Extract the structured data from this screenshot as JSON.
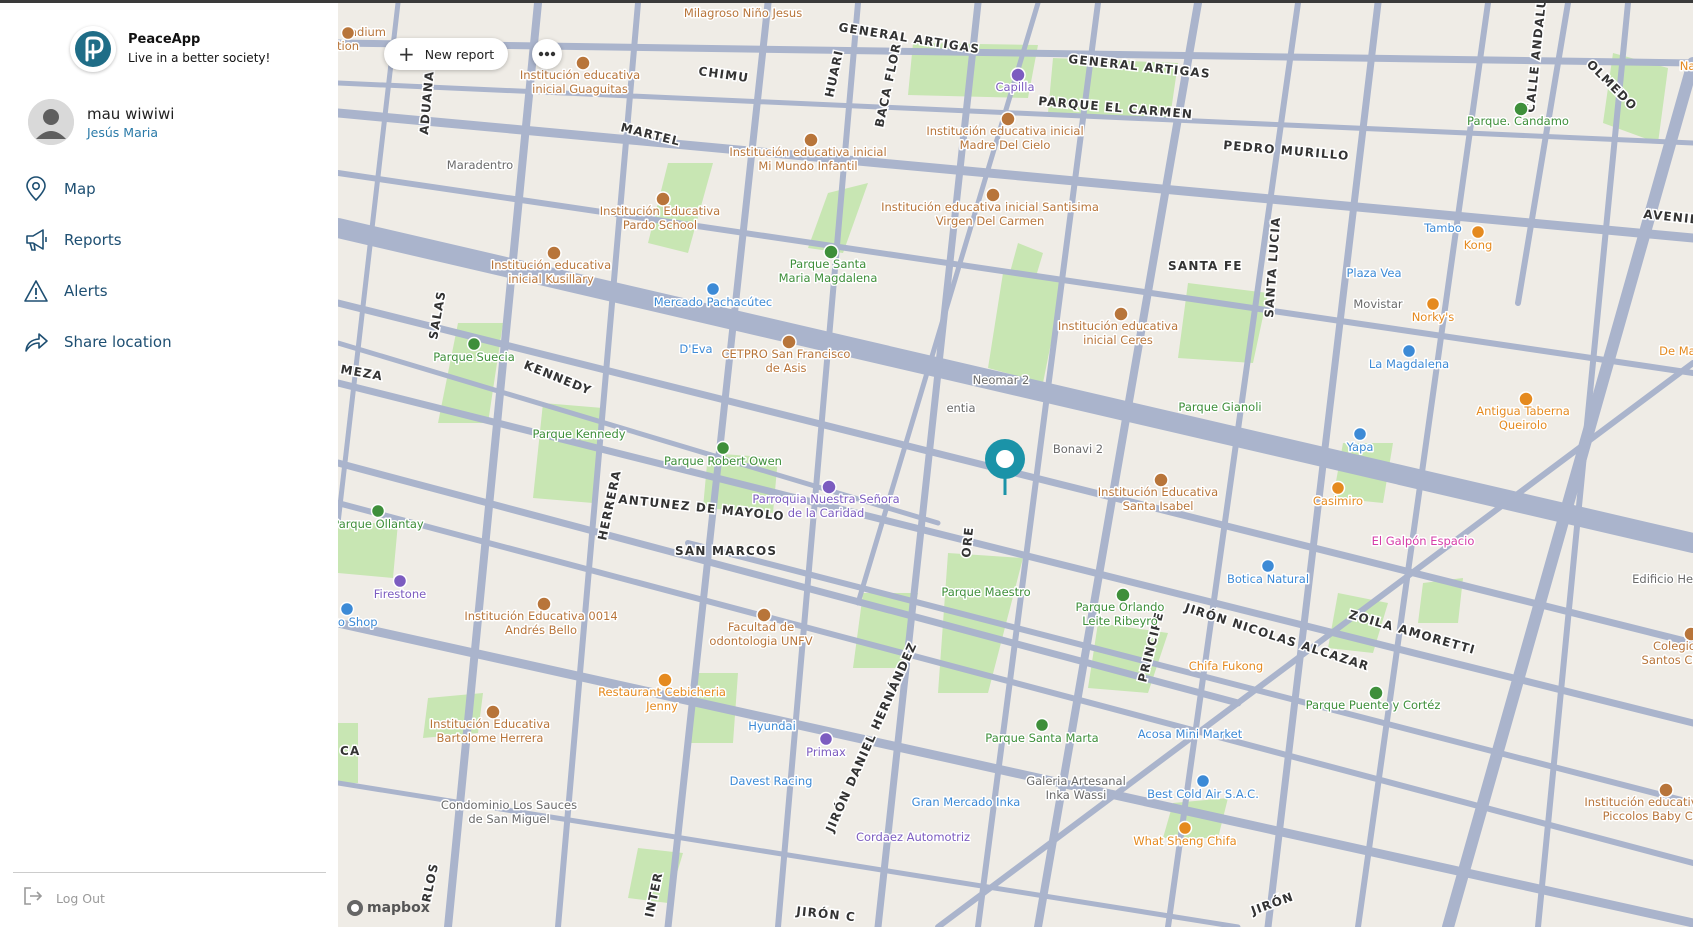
{
  "app": {
    "name": "PeaceApp",
    "tagline": "Live in a better society!"
  },
  "user": {
    "name": "mau wiwiwi",
    "location": "Jesús Maria"
  },
  "nav": {
    "items": [
      {
        "label": "Map",
        "icon": "map-pin-icon"
      },
      {
        "label": "Reports",
        "icon": "megaphone-icon"
      },
      {
        "label": "Alerts",
        "icon": "warning-icon"
      },
      {
        "label": "Share location",
        "icon": "share-arrow-icon"
      }
    ],
    "logout_label": "Log Out"
  },
  "toolbar": {
    "new_report_label": "New report",
    "more_icon": "ellipsis-icon"
  },
  "map": {
    "attribution": "mapbox",
    "pin_color": "#1b93a8",
    "colors": {
      "park": "#c8e6b3",
      "road": "#aab4cc",
      "land": "#efece6",
      "poi_school": "#b8753a",
      "poi_park": "#3e8f3a",
      "poi_shop": "#3c8ad6",
      "poi_food": "#e58a1f",
      "poi_service": "#7c5cc0",
      "poi_art": "#d63ca8"
    },
    "streets": [
      {
        "text": "GENERAL ARTIGAS"
      },
      {
        "text": "GENERAL ARTIGAS"
      },
      {
        "text": "CHIMU"
      },
      {
        "text": "HUARI"
      },
      {
        "text": "BACA FLOR"
      },
      {
        "text": "ADUANA"
      },
      {
        "text": "MARTEL"
      },
      {
        "text": "PARQUE EL CARMEN"
      },
      {
        "text": "PEDRO MURILLO"
      },
      {
        "text": "CALLE ANDALUCIA"
      },
      {
        "text": "OLMEDO"
      },
      {
        "text": "AVENIDA"
      },
      {
        "text": "SANTA FE"
      },
      {
        "text": "SANTA LUCIA"
      },
      {
        "text": "SALAS"
      },
      {
        "text": "MEZA"
      },
      {
        "text": "KENNEDY"
      },
      {
        "text": "ANTUNEZ DE MAYOLO"
      },
      {
        "text": "HERRERA"
      },
      {
        "text": "SAN MARCOS"
      },
      {
        "text": "JIRÓN DANIEL HERNÁNDEZ"
      },
      {
        "text": "ORE"
      },
      {
        "text": "PRINCIPE"
      },
      {
        "text": "JIRÓN NICOLAS ALCAZAR"
      },
      {
        "text": "ZOILA AMORETTI"
      },
      {
        "text": "CA"
      },
      {
        "text": "RLOS"
      },
      {
        "text": "INTER"
      },
      {
        "text": "JIRÓN C"
      },
      {
        "text": "JIRÓN"
      }
    ],
    "pois": [
      {
        "text": "Milagroso Niño Jesus",
        "type": "school"
      },
      {
        "text": "adium",
        "type": "school"
      },
      {
        "text": "tion",
        "type": "school"
      },
      {
        "text": "Institución educativa inicial Guaguitas",
        "type": "school"
      },
      {
        "text": "Capilla",
        "type": "service"
      },
      {
        "text": "Institución educativa inicial Madre Del Cielo",
        "type": "school"
      },
      {
        "text": "Institución educativa inicial Mi Mundo Infantil",
        "type": "school"
      },
      {
        "text": "Maradentro",
        "type": "other"
      },
      {
        "text": "Institución Educativa Pardo School",
        "type": "school"
      },
      {
        "text": "Institución educativa inicial Santisima Virgen Del Carmen",
        "type": "school"
      },
      {
        "text": "Parque. Candamo",
        "type": "park"
      },
      {
        "text": "Tambo",
        "type": "shop"
      },
      {
        "text": "Kong",
        "type": "food"
      },
      {
        "text": "Plaza Vea",
        "type": "shop"
      },
      {
        "text": "Institución educativa inicial Kusillary",
        "type": "school"
      },
      {
        "text": "Parque Santa Maria Magdalena",
        "type": "park"
      },
      {
        "text": "Mercado Pachacútec",
        "type": "shop"
      },
      {
        "text": "Movistar",
        "type": "other"
      },
      {
        "text": "Norky's",
        "type": "food"
      },
      {
        "text": "Institución educativa inicial Ceres",
        "type": "school"
      },
      {
        "text": "Parque Suecia",
        "type": "park"
      },
      {
        "text": "D'Eva",
        "type": "shop"
      },
      {
        "text": "CETPRO San Francisco de Asis",
        "type": "school"
      },
      {
        "text": "De Mam",
        "type": "food"
      },
      {
        "text": "La Magdalena",
        "type": "shop"
      },
      {
        "text": "Neomar 2",
        "type": "other"
      },
      {
        "text": "entia",
        "type": "other"
      },
      {
        "text": "Parque Gianoli",
        "type": "park"
      },
      {
        "text": "Antigua Taberna Queirolo",
        "type": "food"
      },
      {
        "text": "Parque Kennedy",
        "type": "park"
      },
      {
        "text": "Parque Robert Owen",
        "type": "park"
      },
      {
        "text": "Bonavi 2",
        "type": "other"
      },
      {
        "text": "Yapa",
        "type": "shop"
      },
      {
        "text": "Institución Educativa Santa Isabel",
        "type": "school"
      },
      {
        "text": "Casimiro",
        "type": "food"
      },
      {
        "text": "Parroquia Nuestra Señora de la Caridad",
        "type": "service"
      },
      {
        "text": "Parque Ollantay",
        "type": "park"
      },
      {
        "text": "El Galpón Espacio",
        "type": "art"
      },
      {
        "text": "Firestone",
        "type": "service"
      },
      {
        "text": "Parque Maestro",
        "type": "park"
      },
      {
        "text": "Botica Natural",
        "type": "shop"
      },
      {
        "text": "Edificio Herc",
        "type": "other"
      },
      {
        "text": "Institución Educativa 0014 Andrés Bello",
        "type": "school"
      },
      {
        "text": "Parque Orlando Leite Ribeyro",
        "type": "park"
      },
      {
        "text": "Moto Shop",
        "type": "shop"
      },
      {
        "text": "Facultad de odontologia UNFV",
        "type": "school"
      },
      {
        "text": "Colegio Jose Santos Chocano",
        "type": "school"
      },
      {
        "text": "Chifa Fukong",
        "type": "food"
      },
      {
        "text": "Restaurant Cebicheria Jenny",
        "type": "food"
      },
      {
        "text": "Parque Puente y Cortéz",
        "type": "park"
      },
      {
        "text": "Institución Educativa Bartolome Herrera",
        "type": "school"
      },
      {
        "text": "Hyundai",
        "type": "shop"
      },
      {
        "text": "Parque Santa Marta",
        "type": "park"
      },
      {
        "text": "Acosa Mini Market",
        "type": "shop"
      },
      {
        "text": "Primax",
        "type": "service"
      },
      {
        "text": "Davest Racing",
        "type": "shop"
      },
      {
        "text": "Galeria Artesanal Inka Wassi",
        "type": "other"
      },
      {
        "text": "Gran Mercado Inka",
        "type": "shop"
      },
      {
        "text": "Best Cold Air S.A.C.",
        "type": "shop"
      },
      {
        "text": "Institución educativa inicial Piccolos Baby Center",
        "type": "school"
      },
      {
        "text": "Condominio Los Sauces de San Miguel",
        "type": "other"
      },
      {
        "text": "Cordaez Automotriz",
        "type": "service"
      },
      {
        "text": "What Sheng Chifa",
        "type": "food"
      },
      {
        "text": "Nar",
        "type": "food"
      }
    ]
  }
}
